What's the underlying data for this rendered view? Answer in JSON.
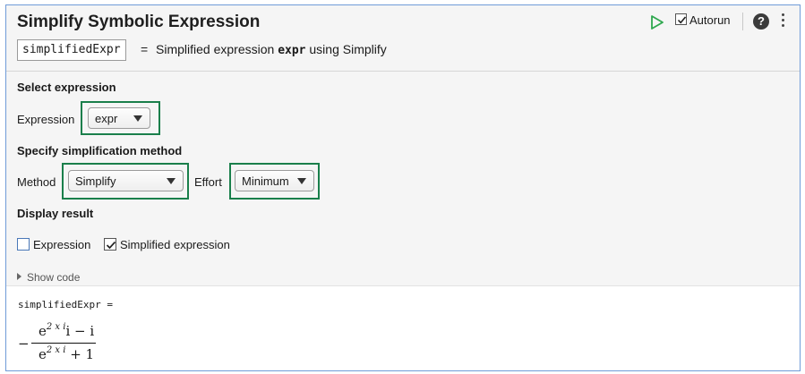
{
  "header": {
    "title": "Simplify Symbolic Expression",
    "output_variable": "simplifiedExpr",
    "equals": "=",
    "summary_prefix": "Simplified expression",
    "summary_code": "expr",
    "summary_suffix": "using Simplify",
    "autorun_label": "Autorun",
    "autorun_checked": true,
    "help_symbol": "?"
  },
  "select_expression": {
    "heading": "Select expression",
    "label": "Expression",
    "value": "expr"
  },
  "method_section": {
    "heading": "Specify simplification method",
    "method_label": "Method",
    "method_value": "Simplify",
    "effort_label": "Effort",
    "effort_value": "Minimum"
  },
  "display": {
    "heading": "Display result",
    "expression_label": "Expression",
    "expression_checked": false,
    "simplified_label": "Simplified expression",
    "simplified_checked": true
  },
  "show_code": "Show code",
  "output": {
    "variable_line": "simplifiedExpr =",
    "minus": "−",
    "numerator_base": "e",
    "numerator_exp": "2 x i",
    "numerator_rest": "i − i",
    "denominator_base": "e",
    "denominator_exp": "2 x i",
    "denominator_rest": " + 1"
  },
  "colors": {
    "highlight": "#1a7f4b",
    "run_icon": "#2fa84f",
    "panel_border": "#6f9bd8"
  },
  "icons": [
    "run-icon",
    "checkbox-icon",
    "help-icon",
    "more-options-icon",
    "dropdown-arrow-icon",
    "expand-triangle-icon"
  ]
}
